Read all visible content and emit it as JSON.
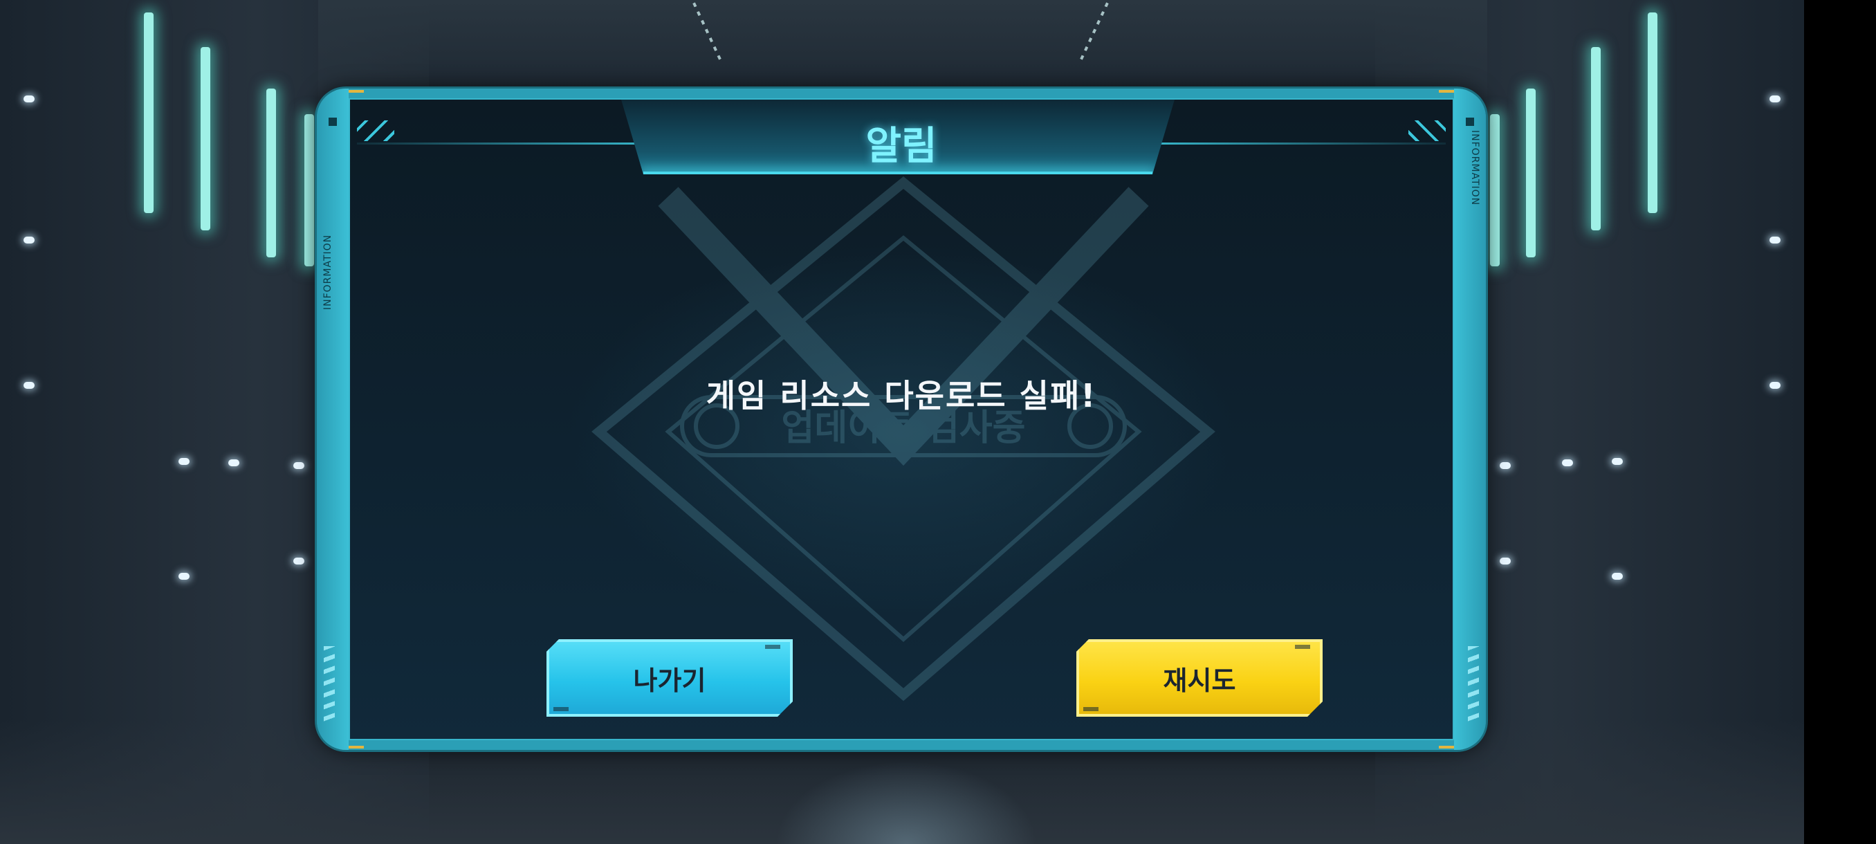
{
  "dialog": {
    "title": "알림",
    "message": "게임 리소스 다운로드 실패!",
    "side_label": "INFORMATION",
    "watermark_text": "업데이트 검사중"
  },
  "buttons": {
    "exit_label": "나가기",
    "retry_label": "재시도"
  },
  "colors": {
    "title": "#7ff2ff",
    "frame": "#2b9fb6",
    "exit_button": "#26c3ea",
    "retry_button": "#fad214"
  }
}
